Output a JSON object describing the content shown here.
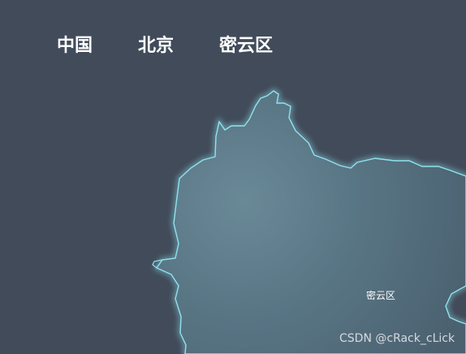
{
  "breadcrumb": {
    "items": [
      "中国",
      "北京",
      "密云区"
    ]
  },
  "map": {
    "region_label": "密云区",
    "fill_color": "#5a7887",
    "border_color": "#8fe3ee",
    "background_color": "#414b5a"
  },
  "watermark": {
    "text": "CSDN @cRack_cLick"
  }
}
